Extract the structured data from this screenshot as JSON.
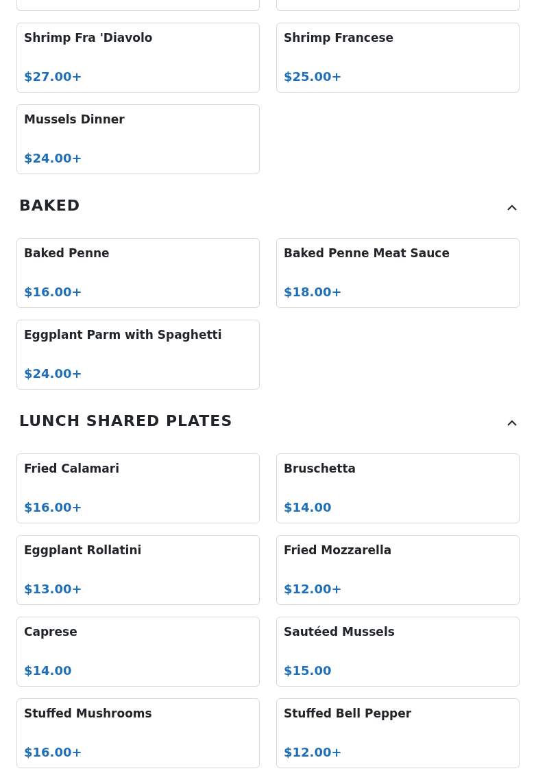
{
  "sections": [
    {
      "items": [
        {
          "name": "Shrimp Fra 'Diavolo",
          "price": "$27.00+"
        },
        {
          "name": "Shrimp Francese",
          "price": "$25.00+"
        },
        {
          "name": "Mussels Dinner",
          "price": "$24.00+"
        }
      ]
    },
    {
      "title": "BAKED",
      "expanded": true,
      "items": [
        {
          "name": "Baked Penne",
          "price": "$16.00+"
        },
        {
          "name": "Baked Penne Meat Sauce",
          "price": "$18.00+"
        },
        {
          "name": "Eggplant Parm with Spaghetti",
          "price": "$24.00+"
        }
      ]
    },
    {
      "title": "LUNCH SHARED PLATES",
      "expanded": true,
      "items": [
        {
          "name": "Fried Calamari",
          "price": "$16.00+"
        },
        {
          "name": "Bruschetta",
          "price": "$14.00"
        },
        {
          "name": "Eggplant Rollatini",
          "price": "$13.00+"
        },
        {
          "name": "Fried Mozzarella",
          "price": "$12.00+"
        },
        {
          "name": "Caprese",
          "price": "$14.00"
        },
        {
          "name": "Sautéed Mussels",
          "price": "$15.00"
        },
        {
          "name": "Stuffed Mushrooms",
          "price": "$16.00+"
        },
        {
          "name": "Stuffed Bell Pepper",
          "price": "$12.00+"
        }
      ]
    }
  ]
}
